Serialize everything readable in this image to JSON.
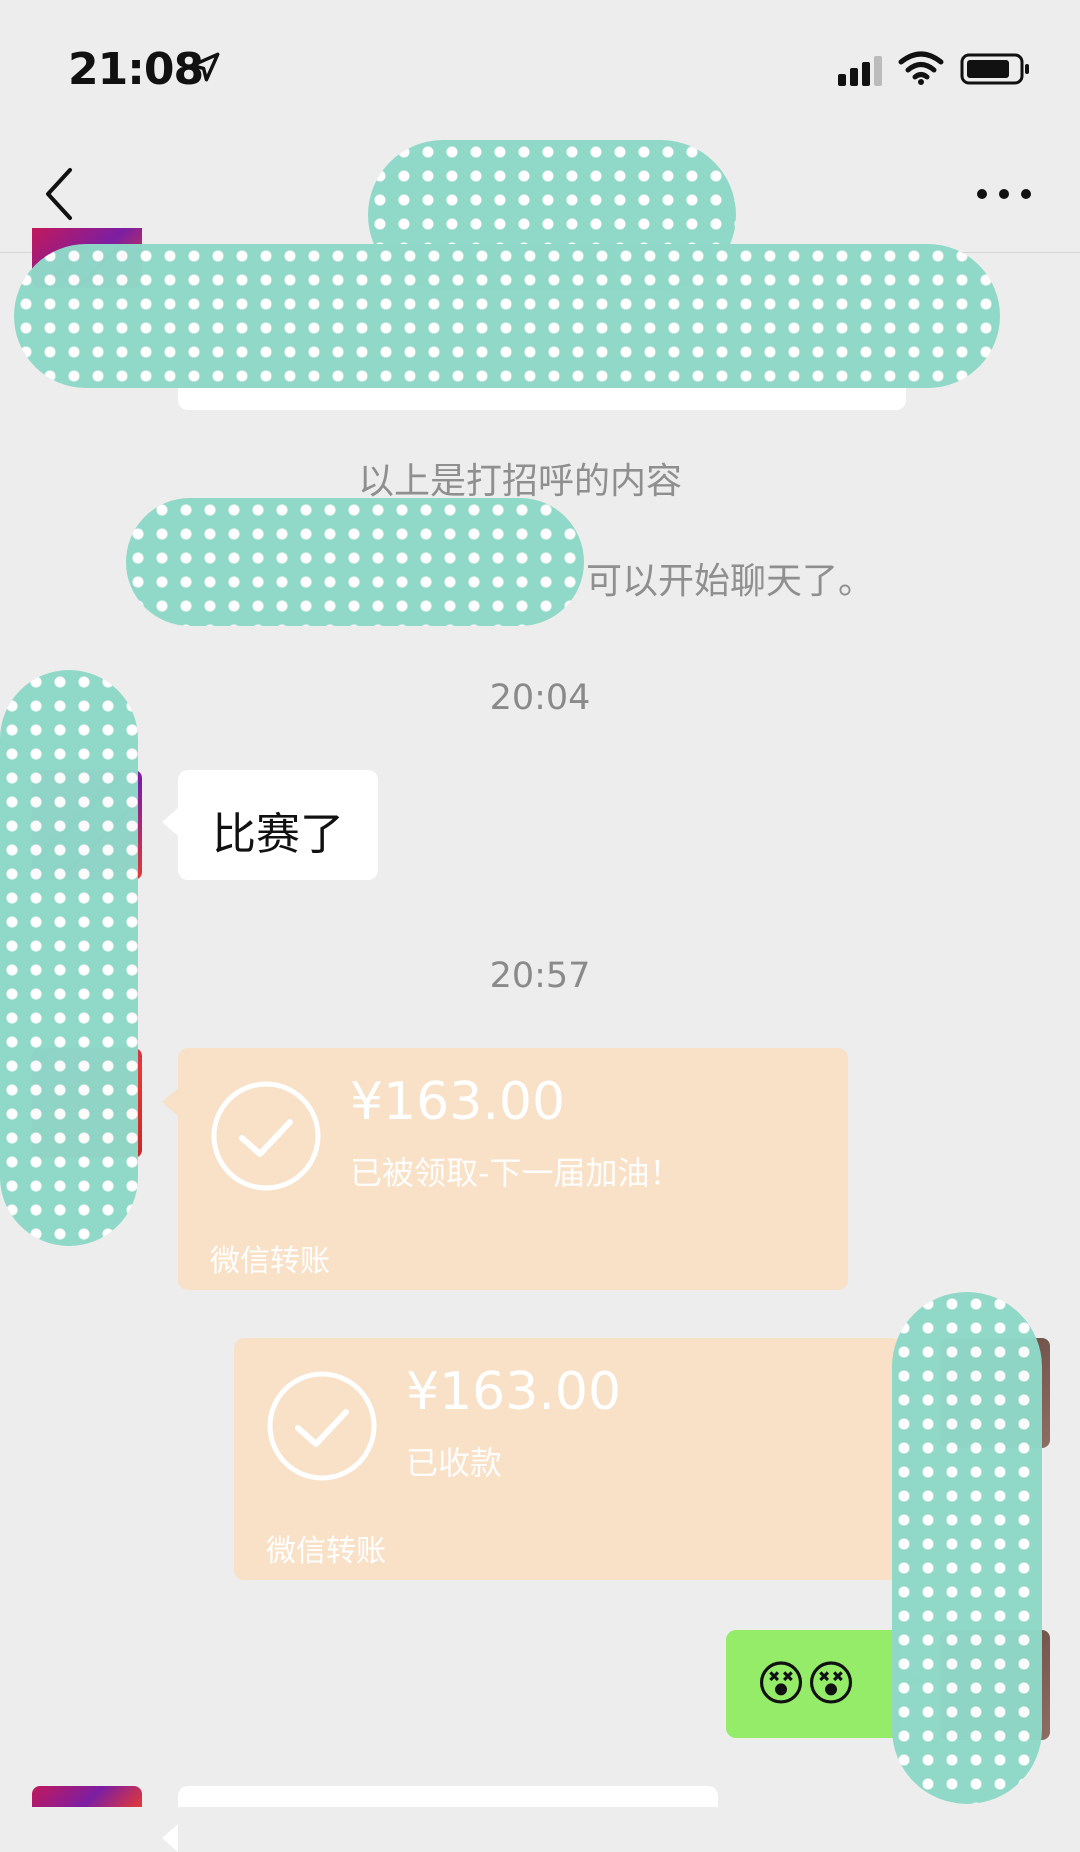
{
  "status_bar": {
    "time": "21:08"
  },
  "nav": {
    "title": ""
  },
  "messages": {
    "greeting_notice": "以上是打招呼的内容",
    "start_chat_notice_fragment": "可以开始聊天了。",
    "timestamp_1": "20:04",
    "incoming_text": "比赛了",
    "timestamp_2": "20:57",
    "transfer_incoming": {
      "amount": "¥163.00",
      "status": "已被领取-下一届加油！",
      "label": "微信转账"
    },
    "transfer_outgoing": {
      "amount": "¥163.00",
      "status": "已收款",
      "label": "微信转账"
    },
    "outgoing_emoji": "😵😵"
  },
  "icons": {
    "back": "chevron-left-icon",
    "more": "more-dots-icon",
    "check": "check-circle-icon",
    "location": "location-arrow-icon",
    "signal": "signal-icon",
    "wifi": "wifi-icon",
    "battery": "battery-icon"
  },
  "colors": {
    "background": "#ededed",
    "incoming_bubble": "#ffffff",
    "outgoing_bubble": "#95ec69",
    "transfer_bubble": "#f8e1c7",
    "redaction": "#8fd8c8"
  }
}
